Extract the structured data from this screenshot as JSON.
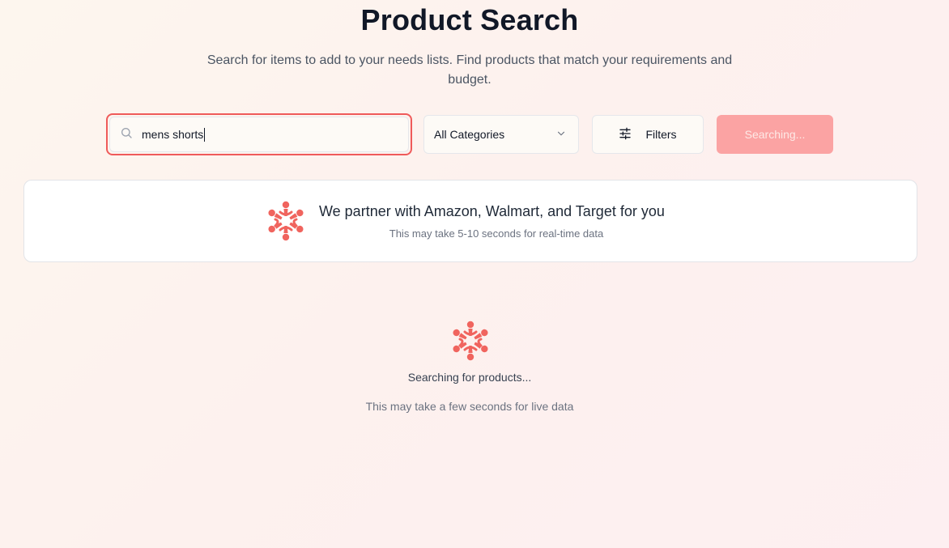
{
  "header": {
    "title": "Product Search",
    "subtitle": "Search for items to add to your needs lists. Find products that match your requirements and budget."
  },
  "search": {
    "value": "mens shorts",
    "icon": "search-icon"
  },
  "category": {
    "selected": "All Categories",
    "icon": "chevron-down-icon"
  },
  "filters": {
    "label": "Filters",
    "icon": "sliders-icon"
  },
  "search_button": {
    "label": "Searching..."
  },
  "partner": {
    "title": "We partner with Amazon, Walmart, and Target for you",
    "note": "This may take 5-10 seconds for real-time data",
    "icon": "brand-logo-icon"
  },
  "loading": {
    "title": "Searching for products...",
    "note": "This may take a few seconds for live data",
    "icon": "brand-logo-icon"
  },
  "colors": {
    "accent": "#ef5a5a",
    "button_disabled": "#fba3a3"
  }
}
